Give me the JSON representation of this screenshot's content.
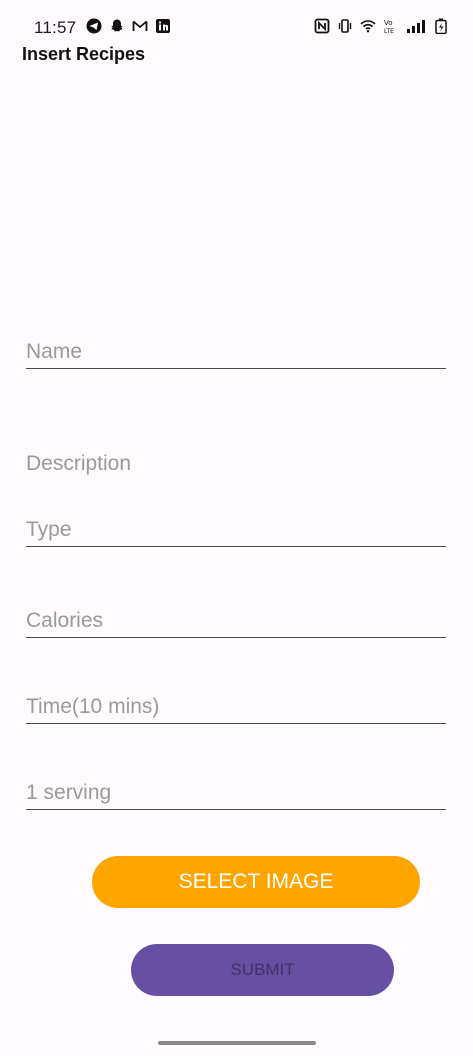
{
  "status_bar": {
    "time": "11:57",
    "left_icons": [
      "telegram-icon",
      "snapchat-icon",
      "gmail-icon",
      "linkedin-icon"
    ],
    "right_icons": [
      "nfc-icon",
      "vibrate-icon",
      "wifi-icon",
      "volte-icon",
      "signal-icon",
      "battery-icon"
    ]
  },
  "app_bar": {
    "title": "Insert Recipes"
  },
  "form": {
    "name_placeholder": "Name",
    "description_placeholder": "Description",
    "type_placeholder": "Type",
    "calories_placeholder": "Calories",
    "time_placeholder": "Time(10 mins)",
    "serving_placeholder": "1 serving"
  },
  "buttons": {
    "select_image": "SELECT IMAGE",
    "submit": "SUBMIT"
  },
  "colors": {
    "background": "#fffbfe",
    "select_button": "#ffa500",
    "submit_button": "#6750a4"
  }
}
